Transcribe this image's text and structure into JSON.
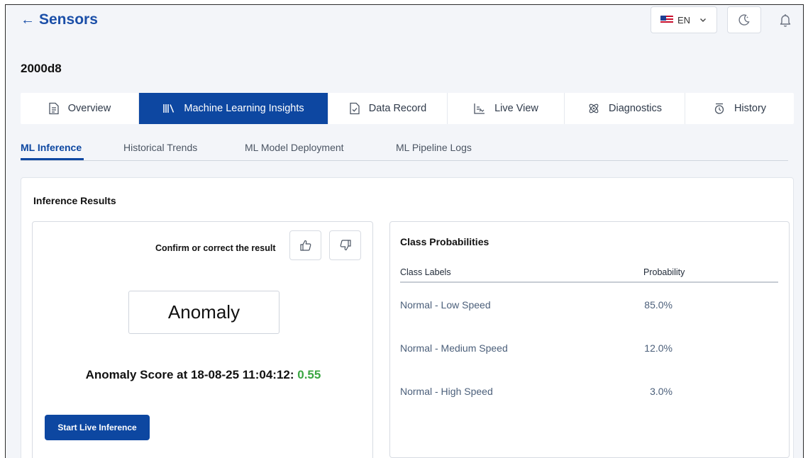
{
  "header": {
    "back_arrow": "←",
    "back_label": "Sensors",
    "language": {
      "code": "EN",
      "flag_icon": "us-flag-icon"
    },
    "theme_icon": "moon-icon",
    "notifications_icon": "bell-icon"
  },
  "device": {
    "id": "2000d8"
  },
  "tabs": [
    {
      "label": "Overview",
      "icon": "document-icon",
      "active": false
    },
    {
      "label": "Machine Learning Insights",
      "icon": "library-icon",
      "active": true
    },
    {
      "label": "Data Record",
      "icon": "file-check-icon",
      "active": false
    },
    {
      "label": "Live View",
      "icon": "chart-pulse-icon",
      "active": false
    },
    {
      "label": "Diagnostics",
      "icon": "atom-icon",
      "active": false
    },
    {
      "label": "History",
      "icon": "history-clock-icon",
      "active": false
    }
  ],
  "subtabs": [
    {
      "label": "ML Inference",
      "active": true
    },
    {
      "label": "Historical Trends",
      "active": false
    },
    {
      "label": "ML Model Deployment",
      "active": false
    },
    {
      "label": "ML Pipeline Logs",
      "active": false
    }
  ],
  "results": {
    "title": "Inference Results",
    "feedback_prompt": "Confirm or correct the result",
    "result_label": "Anomaly",
    "score_prefix": "Anomaly Score at 18-08-25 11:04:12:",
    "score_value": "0.55",
    "start_button": "Start Live Inference"
  },
  "probabilities": {
    "title": "Class Probabilities",
    "columns": [
      "Class Labels",
      "Probability"
    ],
    "rows": [
      {
        "label": "Normal - Low Speed",
        "value": "85.0%"
      },
      {
        "label": "Normal - Medium Speed",
        "value": "12.0%"
      },
      {
        "label": "Normal - High Speed",
        "value": "3.0%"
      }
    ]
  },
  "colors": {
    "primary": "#0d47a1",
    "score_green": "#3aa642",
    "background": "#f3f5f9"
  }
}
